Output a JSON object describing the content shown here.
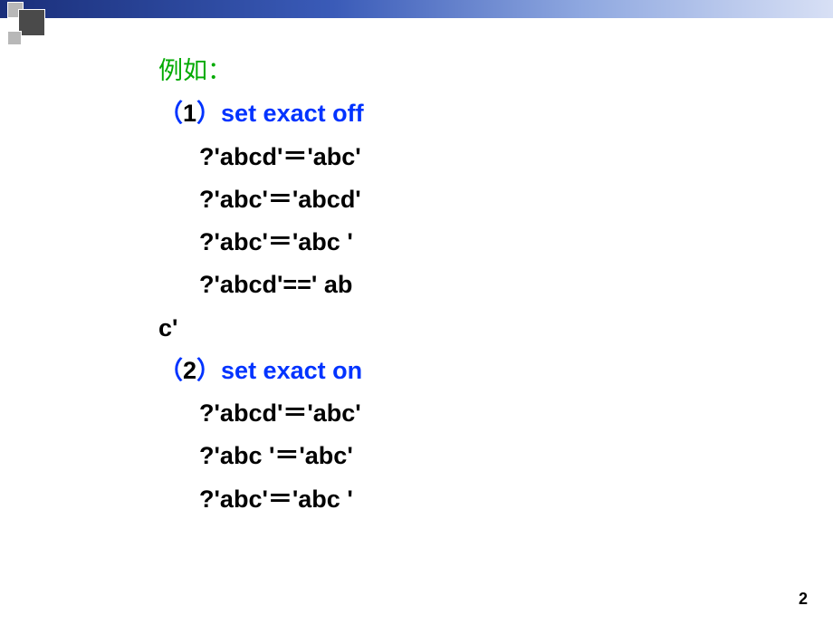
{
  "header": {
    "example_label": "例如："
  },
  "sections": [
    {
      "number": "1",
      "command": "set exact off",
      "lines": [
        "?'abcd'＝'abc'",
        "?'abc'＝'abcd'",
        "?'abc'＝'abc '",
        "?'abcd'==' ab",
        "c'"
      ]
    },
    {
      "number": "2",
      "command": "set exact on",
      "lines": [
        "?'abcd'＝'abc'",
        "?'abc '＝'abc'",
        "?'abc'＝'abc '"
      ]
    }
  ],
  "page_number": "2"
}
